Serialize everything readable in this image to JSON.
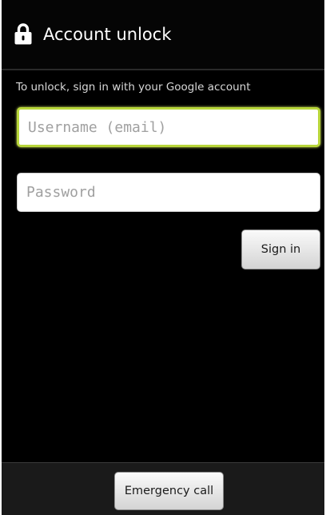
{
  "header": {
    "title": "Account unlock",
    "icon": "lock-icon"
  },
  "form": {
    "instructions": "To unlock, sign in with your Google account",
    "username": {
      "placeholder": "Username (email)",
      "value": ""
    },
    "password": {
      "placeholder": "Password",
      "value": ""
    },
    "sign_in_label": "Sign in"
  },
  "footer": {
    "emergency_call_label": "Emergency call"
  },
  "colors": {
    "background": "#000000",
    "focus_border": "#b8d63a",
    "field_background": "#ffffff",
    "bottom_bar": "#1a1a1a"
  }
}
